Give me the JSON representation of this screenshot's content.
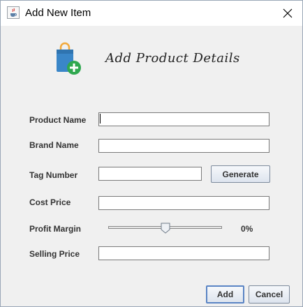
{
  "window": {
    "title": "Add New Item",
    "app_icon": "java-cup-icon",
    "close_icon": "close-icon"
  },
  "header": {
    "logo_icon": "shopping-bag-add-icon",
    "heading": "Add Product Details"
  },
  "form": {
    "product_name": {
      "label": "Product Name",
      "value": ""
    },
    "brand_name": {
      "label": "Brand Name",
      "value": ""
    },
    "tag_number": {
      "label": "Tag Number",
      "value": "",
      "generate_label": "Generate"
    },
    "cost_price": {
      "label": "Cost Price",
      "value": ""
    },
    "profit_margin": {
      "label": "Profit Margin",
      "value_text": "0%",
      "slider_value": 0.5
    },
    "selling_price": {
      "label": "Selling Price",
      "value": ""
    }
  },
  "footer": {
    "add_label": "Add",
    "cancel_label": "Cancel"
  },
  "colors": {
    "bag_blue": "#3a86c8",
    "bag_handle": "#f2a93b",
    "plus_green": "#2fa84f"
  }
}
